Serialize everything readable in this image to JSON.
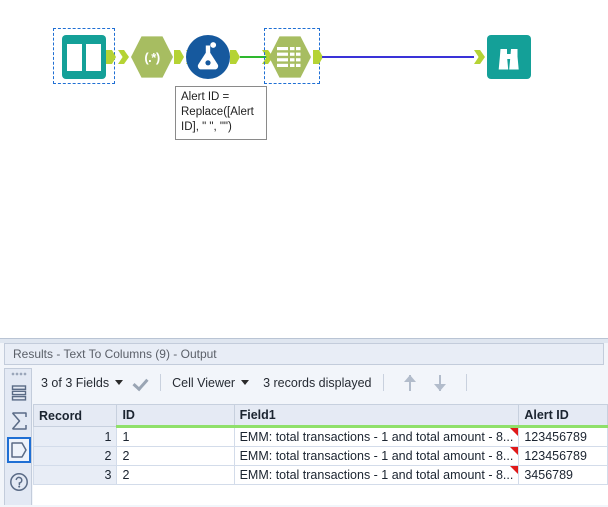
{
  "canvas": {
    "tools": [
      {
        "id": "input-data",
        "name": "Input Data",
        "glyph": "book-icon",
        "selected": true
      },
      {
        "id": "regex",
        "name": "RegEx",
        "glyph": "regex-icon",
        "label": "(.*)",
        "selected": false
      },
      {
        "id": "formula",
        "name": "Formula",
        "glyph": "flask-icon",
        "selected": false
      },
      {
        "id": "text-to-columns",
        "name": "Text To Columns",
        "glyph": "table-grid-icon",
        "selected": true
      },
      {
        "id": "browse",
        "name": "Browse",
        "glyph": "binoculars-icon",
        "selected": false
      }
    ],
    "annotation": {
      "line1": "Alert ID =",
      "line2": "Replace([Alert",
      "line3": "ID], \" \", \"\")"
    },
    "colors": {
      "teal": "#14a098",
      "olive": "#a7bd61",
      "blue": "#16599e",
      "anchor": "#b5d334",
      "wire_green": "#2eb82e",
      "wire_blue": "#3a32d8",
      "selection": "#1f6fd4"
    }
  },
  "results": {
    "title": "Results - Text To Columns (9) - Output",
    "rail": [
      {
        "name": "messages-icon",
        "selected": false
      },
      {
        "name": "sigma-icon",
        "selected": false
      },
      {
        "name": "pentagon-icon",
        "selected": true
      },
      {
        "name": "help-icon",
        "selected": false
      }
    ],
    "toolbar": {
      "fields_label": "3 of 3 Fields",
      "view_label": "Cell Viewer",
      "records_label": "3 records displayed",
      "up_arrow": "arrow-up-icon",
      "down_arrow": "arrow-down-icon",
      "check": "checkmark-icon"
    },
    "table": {
      "columns": [
        "Record",
        "ID",
        "Field1",
        "Alert ID"
      ],
      "rows": [
        {
          "record": "1",
          "id": "1",
          "field1": "EMM: total transactions - 1 and total amount - 8...",
          "alert_id": "123456789"
        },
        {
          "record": "2",
          "id": "2",
          "field1": "EMM: total transactions - 1 and total amount - 8...",
          "alert_id": "123456789"
        },
        {
          "record": "3",
          "id": "2",
          "field1": "EMM: total transactions - 1 and total amount - 8...",
          "alert_id": "3456789"
        }
      ]
    }
  }
}
